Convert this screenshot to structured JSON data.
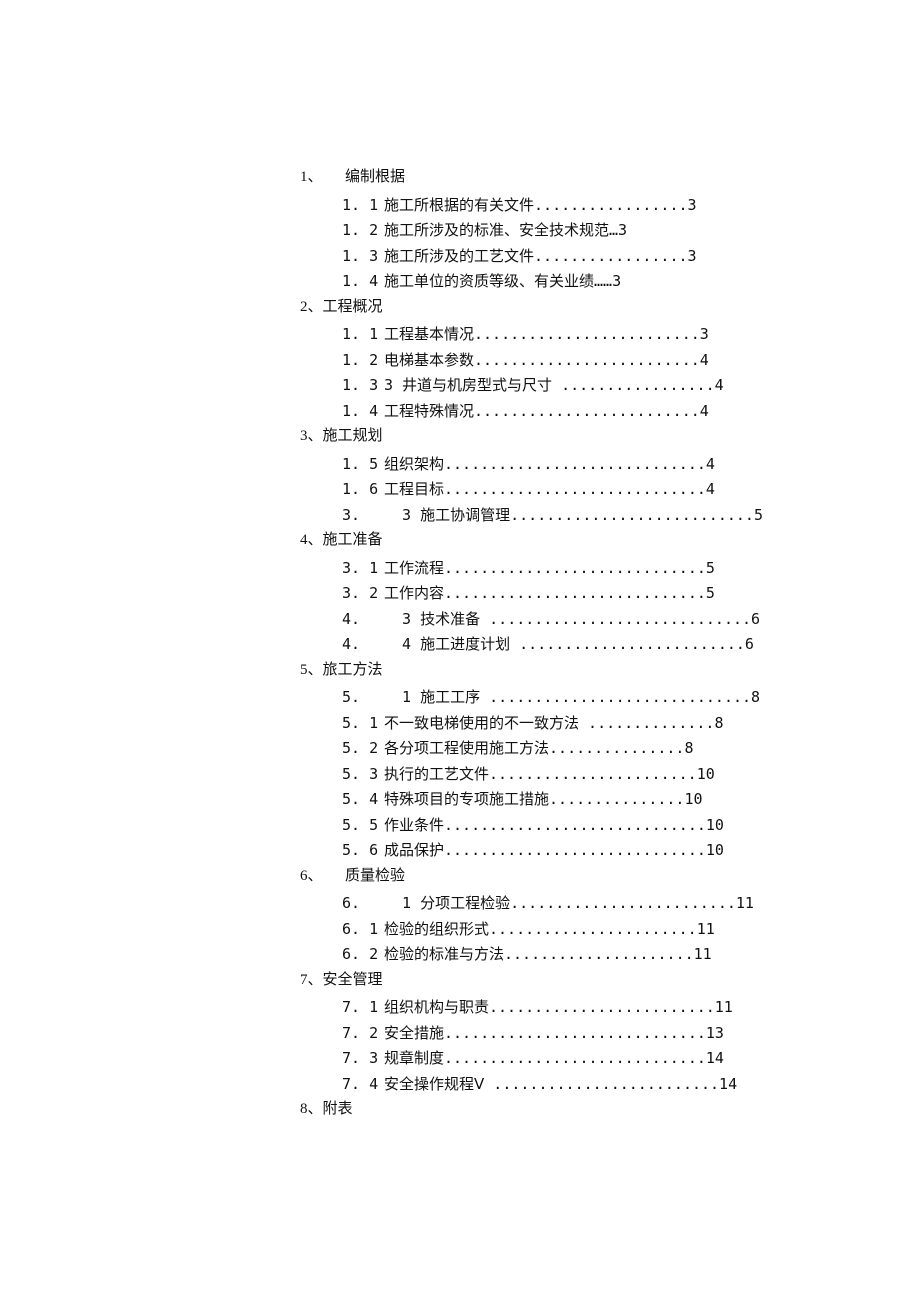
{
  "sections": [
    {
      "num": "1、",
      "gap": "      ",
      "title": "编制根据",
      "items": [
        {
          "num": "1. 1",
          "label": "施工所根据的有关文件.................3"
        },
        {
          "num": "1. 2",
          "label": "施工所涉及的标准、安全技术规范…3"
        },
        {
          "num": "1. 3",
          "label": "施工所涉及的工艺文件.................3"
        },
        {
          "num": "1. 4",
          "label": "施工单位的资质等级、有关业绩……3"
        }
      ]
    },
    {
      "num": "2、",
      "gap": "",
      "title": "工程概况",
      "items": [
        {
          "num": "1. 1",
          "label": "工程基本情况.........................3"
        },
        {
          "num": "1. 2",
          "label": "电梯基本参数.........................4"
        },
        {
          "num": "1. 3",
          "label": "3 井道与机房型式与尺寸 .................4"
        },
        {
          "num": "1. 4",
          "label": "工程特殊情况.........................4"
        }
      ]
    },
    {
      "num": "3、",
      "gap": "",
      "title": "施工规划",
      "items": [
        {
          "num": "1. 5",
          "label": "组织架构.............................4"
        },
        {
          "num": "1. 6",
          "label": "工程目标.............................4"
        },
        {
          "num": "3.",
          "label": "  3 施工协调管理...........................5"
        }
      ]
    },
    {
      "num": "4、",
      "gap": "",
      "title": "施工准备",
      "items": [
        {
          "num": "3. 1",
          "label": "工作流程.............................5"
        },
        {
          "num": "3. 2",
          "label": "工作内容.............................5"
        },
        {
          "num": "4.",
          "label": "  3 技术准备 .............................6"
        },
        {
          "num": "4.",
          "label": "  4 施工进度计划 .........................6"
        }
      ]
    },
    {
      "num": "5、",
      "gap": "",
      "title": "旅工方法",
      "items": [
        {
          "num": "5.",
          "label": "  1 施工工序 .............................8"
        },
        {
          "num": "5. 1",
          "label": "不一致电梯使用的不一致方法 ..............8"
        },
        {
          "num": "5. 2",
          "label": "各分项工程使用施工方法...............8"
        },
        {
          "num": "5. 3",
          "label": "执行的工艺文件.......................10"
        },
        {
          "num": "5. 4",
          "label": "特殊项目的专项施工措施...............10"
        },
        {
          "num": "5. 5",
          "label": "作业条件.............................10"
        },
        {
          "num": "5. 6",
          "label": "成品保护.............................10"
        }
      ]
    },
    {
      "num": "6、",
      "gap": "      ",
      "title": "质量检验",
      "items": [
        {
          "num": "6.",
          "label": "  1 分项工程检验.........................11"
        },
        {
          "num": "6. 1",
          "label": "检验的组织形式.......................11"
        },
        {
          "num": "6. 2",
          "label": "检验的标准与方法.....................11"
        }
      ]
    },
    {
      "num": "7、",
      "gap": "",
      "title": "安全管理",
      "items": [
        {
          "num": "7. 1",
          "label": "组织机构与职责.........................11"
        },
        {
          "num": "7. 2",
          "label": "安全措施.............................13"
        },
        {
          "num": "7. 3",
          "label": "规章制度.............................14"
        },
        {
          "num": "7. 4",
          "label": "安全操作规程Ⅴ .........................14"
        }
      ]
    },
    {
      "num": "8、",
      "gap": "",
      "title": "附表",
      "items": []
    }
  ]
}
